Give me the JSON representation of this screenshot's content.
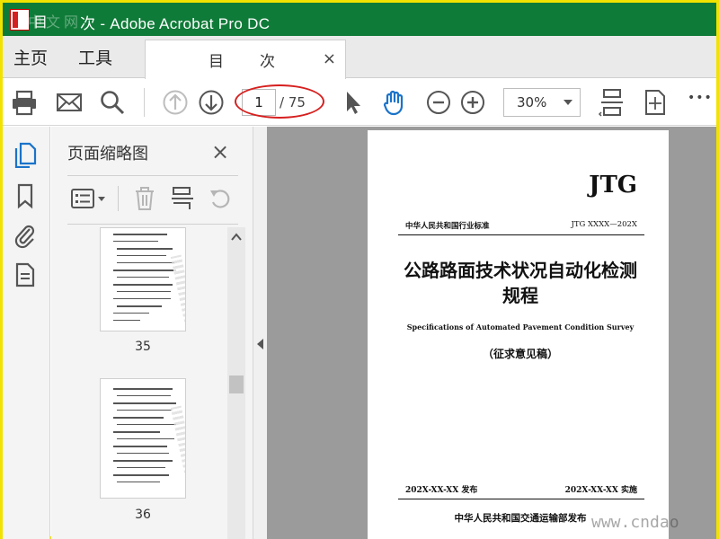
{
  "window": {
    "title": "次 - Adobe Acrobat Pro DC",
    "title_prefix_glyph": "目",
    "watermark_top_left": "中文网"
  },
  "menu": {
    "home_label": "主页",
    "tools_label": "工具"
  },
  "tab": {
    "title": "目次",
    "close_glyph": "×"
  },
  "toolbar": {
    "print_icon": "print-icon",
    "email_icon": "email-icon",
    "search_icon": "search-icon",
    "prev_page_icon": "arrow-up-circle-icon",
    "next_page_icon": "arrow-down-circle-icon",
    "current_page": "1",
    "page_total": "/ 75",
    "zoom_value": "30%",
    "more_glyph": "•••"
  },
  "thumbnails_panel": {
    "title": "页面缩略图",
    "close_glyph": "×",
    "pages": [
      {
        "number": "35"
      },
      {
        "number": "36"
      }
    ]
  },
  "document_page": {
    "code": "JTG",
    "standard_type": "中华人民共和国行业标准",
    "standard_number": "JTG XXXX—202X",
    "title_line1": "公路路面技术状况自动化检测",
    "title_line2": "规程",
    "english_title": "Specifications of Automated Pavement Condition Survey",
    "draft_note": "（征求意见稿）",
    "issue_date": "202X-XX-XX 发布",
    "implement_date": "202X-XX-XX 实施",
    "publisher": "中华人民共和国交通运输部发布"
  },
  "watermark_bottom_right": "www.cndao",
  "colors": {
    "title_bar": "#0f7b38",
    "highlight_ellipse": "#d6201f",
    "hand_tool_active": "#1a73c9",
    "screen_border": "#f2e200"
  }
}
